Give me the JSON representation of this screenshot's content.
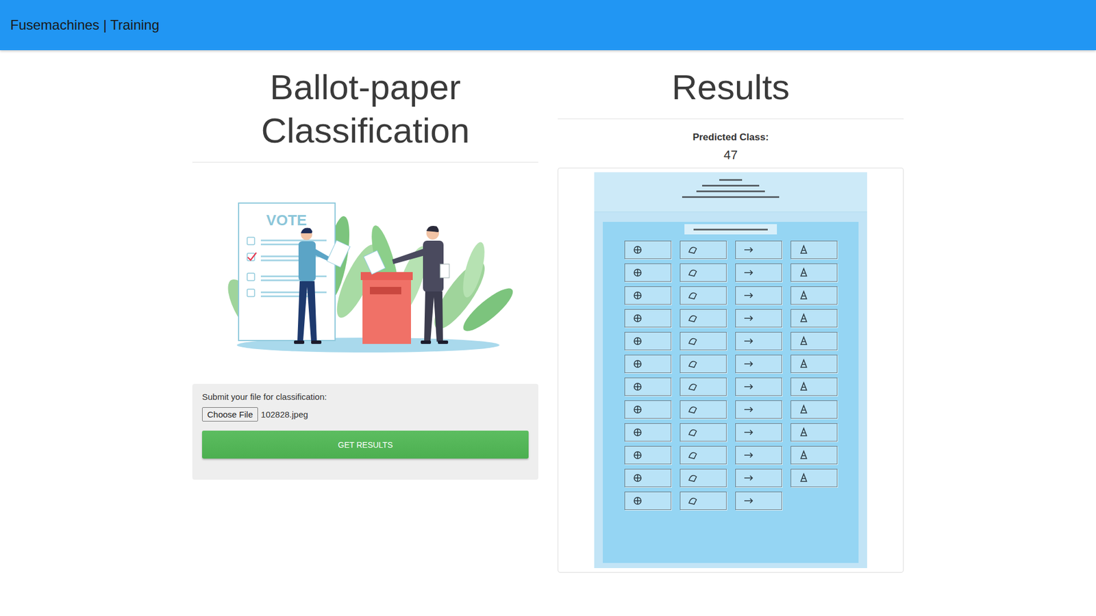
{
  "navbar": {
    "brand": "Fusemachines | Training"
  },
  "upload_panel": {
    "title": "Ballot-paper Classification",
    "illustration": {
      "caption": "VOTE",
      "checklist": [
        {
          "checked": false
        },
        {
          "checked": true
        },
        {
          "checked": false
        },
        {
          "checked": false
        }
      ]
    },
    "form": {
      "label": "Submit your file for classification:",
      "file_button": "Choose File",
      "file_name": "102828.jpeg",
      "submit": "GET RESULTS"
    }
  },
  "results_panel": {
    "title": "Results",
    "prediction_label": "Predicted Class:",
    "prediction_value": "47"
  }
}
